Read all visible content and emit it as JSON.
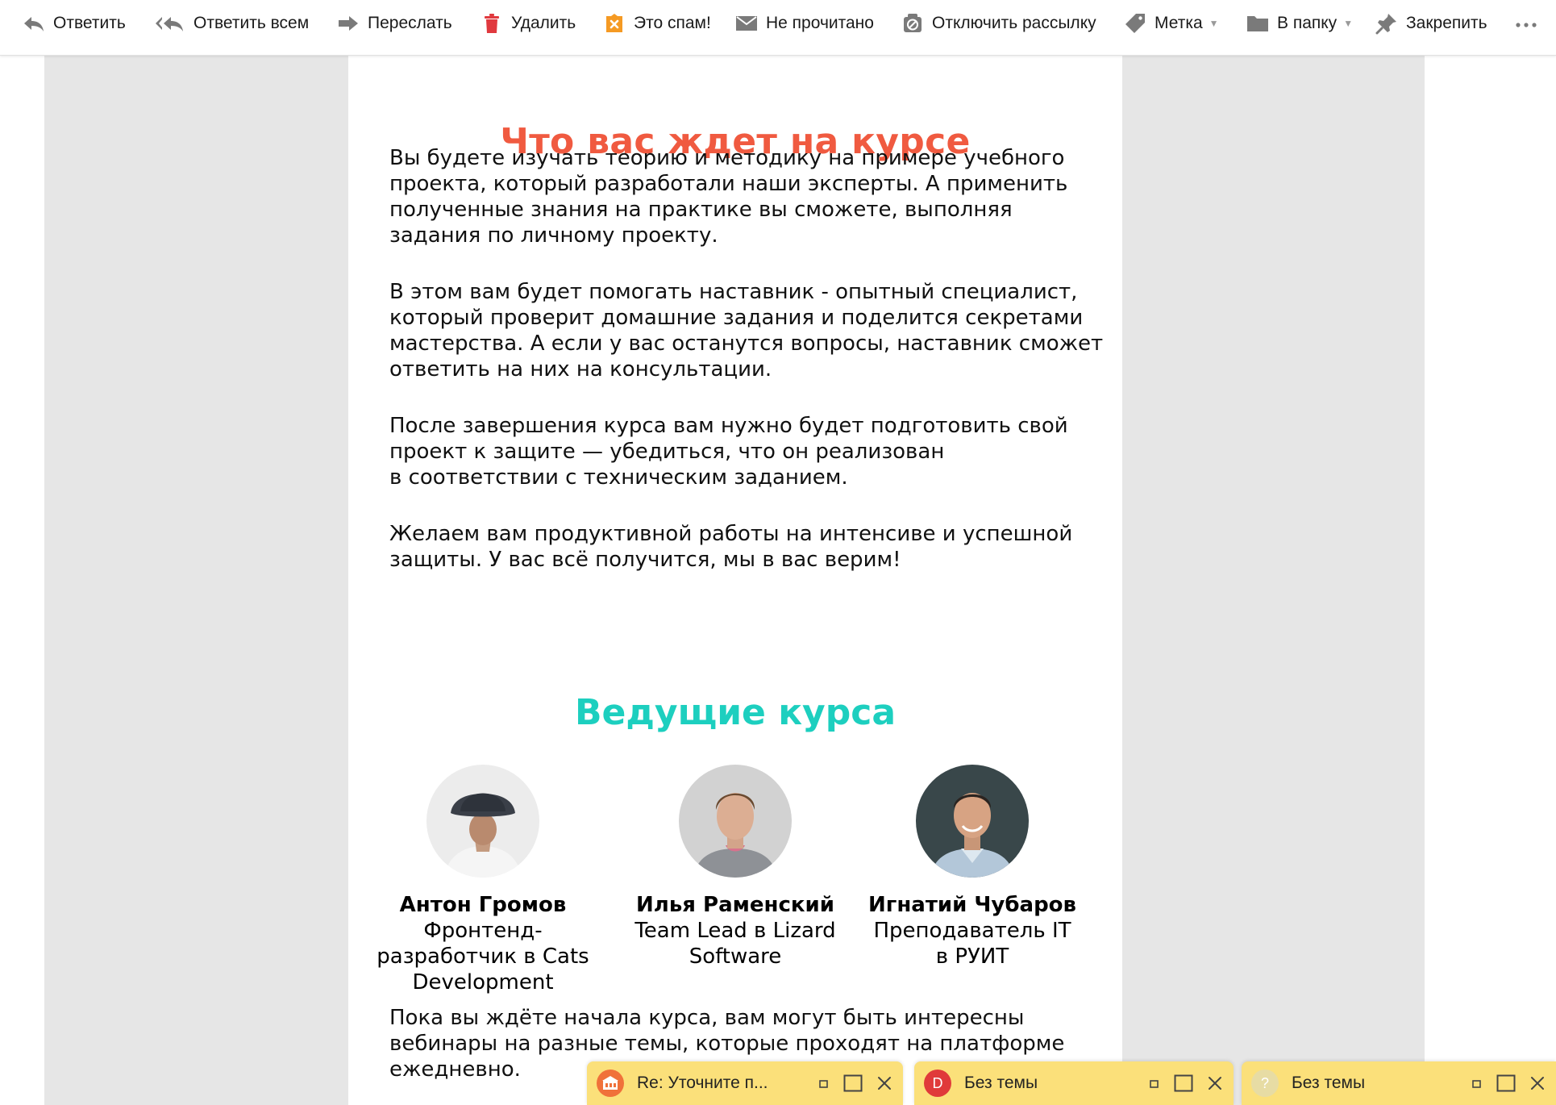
{
  "toolbar": {
    "reply": "Ответить",
    "reply_all": "Ответить всем",
    "forward": "Переслать",
    "delete": "Удалить",
    "spam": "Это спам!",
    "unread": "Не прочитано",
    "unsubscribe": "Отключить рассылку",
    "label": "Метка",
    "to_folder": "В папку",
    "pin": "Закрепить",
    "more": "···"
  },
  "colors": {
    "heading_red": "#f05a40",
    "heading_teal": "#1dcfbf",
    "viewer_bg": "#e6e6e6",
    "draft_bg": "#fbe07a",
    "delete_icon": "#e0393e",
    "spam_icon": "#f59a23"
  },
  "email": {
    "heading_course": "Что вас ждет на курсе",
    "paragraphs": [
      {
        "lines": [
          "Вы будете изучать теорию и методику на примере учебного",
          "проекта, который разработали наши эксперты. А применить",
          "полученные знания на практике вы сможете, выполняя",
          "задания по личному проекту."
        ]
      },
      {
        "lines": [
          "В этом вам будет помогать наставник - опытный специалист,",
          "который проверит домашние задания и поделится секретами",
          "мастерства. А если у вас останутся вопросы, наставник сможет",
          "ответить на них на консультации."
        ]
      },
      {
        "lines": [
          "После завершения курса вам нужно будет подготовить свой",
          "проект к защите — убедиться, что он реализован",
          "в соответствии с техническим заданием."
        ]
      },
      {
        "lines": [
          "Желаем вам продуктивной работы на интенсиве и успешной",
          "защиты. У вас всё получится, мы в вас верим!"
        ]
      }
    ],
    "heading_hosts": "Ведущие курса",
    "hosts": [
      {
        "name": "Антон Громов",
        "role_lines": [
          "Фронтенд-",
          "разработчик в Cats",
          "Development"
        ]
      },
      {
        "name": "Илья Раменский",
        "role_lines": [
          "Team Lead в Lizard",
          "Software"
        ]
      },
      {
        "name": "Игнатий Чубаров",
        "role_lines": [
          "Преподаватель IT",
          "в РУИТ"
        ]
      }
    ],
    "footer_para": {
      "lines": [
        "Пока вы ждёте начала курса, вам могут быть интересны",
        "вебинары на разные темы, которые проходят на платформе",
        "ежедневно."
      ]
    }
  },
  "drafts": [
    {
      "title": "Re: Уточните п...",
      "avatar_letter": "",
      "avatar_color": "#f0713a"
    },
    {
      "title": "Без темы",
      "avatar_letter": "D",
      "avatar_color": "#e03a3a"
    },
    {
      "title": "Без темы",
      "avatar_letter": "?",
      "avatar_color": "#e7dca4"
    }
  ]
}
